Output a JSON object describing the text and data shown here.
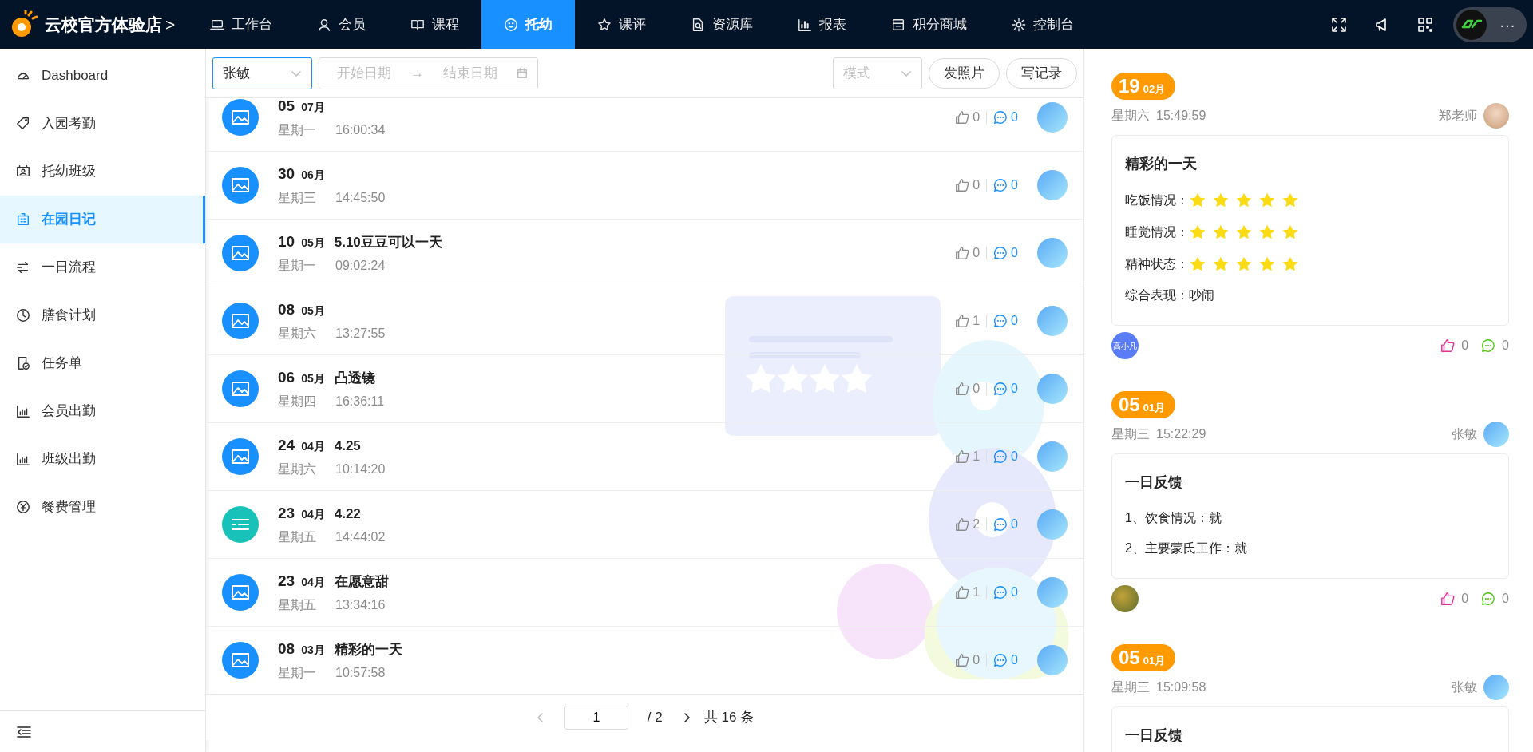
{
  "topbar": {
    "brand": "云校官方体验店",
    "brand_chevron": ">",
    "tabs": [
      {
        "label": "工作台",
        "selected": false
      },
      {
        "label": "会员",
        "selected": false
      },
      {
        "label": "课程",
        "selected": false
      },
      {
        "label": "托幼",
        "selected": true
      },
      {
        "label": "课评",
        "selected": false
      },
      {
        "label": "资源库",
        "selected": false
      },
      {
        "label": "报表",
        "selected": false
      },
      {
        "label": "积分商城",
        "selected": false
      },
      {
        "label": "控制台",
        "selected": false
      }
    ],
    "user_more": "···"
  },
  "sidebar": {
    "items": [
      {
        "label": "Dashboard",
        "selected": false
      },
      {
        "label": "入园考勤",
        "selected": false
      },
      {
        "label": "托幼班级",
        "selected": false
      },
      {
        "label": "在园日记",
        "selected": true
      },
      {
        "label": "一日流程",
        "selected": false
      },
      {
        "label": "膳食计划",
        "selected": false
      },
      {
        "label": "任务单",
        "selected": false
      },
      {
        "label": "会员出勤",
        "selected": false
      },
      {
        "label": "班级出勤",
        "selected": false
      },
      {
        "label": "餐费管理",
        "selected": false
      }
    ]
  },
  "filters": {
    "teacher": "张敏",
    "start_date": {
      "placeholder": "开始日期"
    },
    "arrow": "→",
    "end_date": {
      "placeholder": "结束日期"
    },
    "mode": {
      "placeholder": "模式"
    },
    "buttons": [
      "发照片",
      "写记录"
    ]
  },
  "rows": [
    {
      "kind": "image",
      "day": "05",
      "month": "07月",
      "weekday": "星期一",
      "time": "16:00:34",
      "likes": "0",
      "comments": "0"
    },
    {
      "kind": "image",
      "day": "30",
      "month": "06月",
      "weekday": "星期三",
      "time": "14:45:50",
      "likes": "0",
      "comments": "0"
    },
    {
      "kind": "image",
      "day": "10",
      "month": "05月",
      "title": "5.10豆豆可以一天",
      "weekday": "星期一",
      "time": "09:02:24",
      "likes": "0",
      "comments": "0"
    },
    {
      "kind": "image",
      "day": "08",
      "month": "05月",
      "weekday": "星期六",
      "time": "13:27:55",
      "likes": "1",
      "comments": "0"
    },
    {
      "kind": "image",
      "day": "06",
      "month": "05月",
      "title": "凸透镜",
      "weekday": "星期四",
      "time": "16:36:11",
      "likes": "0",
      "comments": "0"
    },
    {
      "kind": "image",
      "day": "24",
      "month": "04月",
      "title": "4.25",
      "weekday": "星期六",
      "time": "10:14:20",
      "likes": "1",
      "comments": "0"
    },
    {
      "kind": "text",
      "day": "23",
      "month": "04月",
      "title": "4.22",
      "weekday": "星期五",
      "time": "14:44:02",
      "likes": "2",
      "comments": "0"
    },
    {
      "kind": "image",
      "day": "23",
      "month": "04月",
      "title": "在愿意甜",
      "weekday": "星期五",
      "time": "13:34:16",
      "likes": "1",
      "comments": "0"
    },
    {
      "kind": "image",
      "day": "08",
      "month": "03月",
      "title": "精彩的一天",
      "weekday": "星期一",
      "time": "10:57:58",
      "likes": "0",
      "comments": "0"
    }
  ],
  "pagination": {
    "page": "1",
    "of_pages": "/ 2",
    "total": "共 16 条"
  },
  "entries": [
    {
      "day": "19",
      "month": "02月",
      "weekday": "星期六",
      "time": "15:49:59",
      "author": "郑老师",
      "title": "精彩的一天",
      "kind": "ratings",
      "ratings": [
        {
          "label": "吃饭情况：",
          "stars": 5
        },
        {
          "label": "睡觉情况：",
          "stars": 5
        },
        {
          "label": "精神状态：",
          "stars": 5
        }
      ],
      "lines": [
        "综合表现：吵闹"
      ],
      "reader": {
        "kind": "initials",
        "text": "高小凡"
      },
      "likes": "0",
      "comments": "0"
    },
    {
      "day": "05",
      "month": "01月",
      "weekday": "星期三",
      "time": "15:22:29",
      "author": "张敏",
      "title": "一日反馈",
      "kind": "list",
      "lines": [
        "1、饮食情况：就",
        "2、主要蒙氏工作：就"
      ],
      "reader": {
        "kind": "photo"
      },
      "likes": "0",
      "comments": "0"
    },
    {
      "day": "05",
      "month": "01月",
      "weekday": "星期三",
      "time": "15:09:58",
      "author": "张敏",
      "title": "一日反馈",
      "kind": "list"
    }
  ]
}
